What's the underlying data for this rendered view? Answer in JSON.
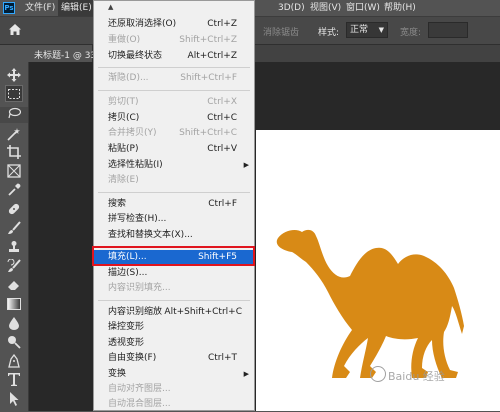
{
  "app": {
    "logo": "Ps"
  },
  "menubar": {
    "file": "文件(F)",
    "edit": "编辑(E)",
    "extra_3d": "3D(D)",
    "view": "视图(V)",
    "window": "窗口(W)",
    "help": "帮助(H)"
  },
  "options": {
    "mode_partial": "消除锯齿",
    "style_label": "样式:",
    "style_value": "正常",
    "width_label": "宽度:"
  },
  "document": {
    "tab_title": "未标题-1 @ 33"
  },
  "edit_menu": {
    "items": [
      {
        "label": "还原取消选择(O)",
        "shortcut": "Ctrl+Z"
      },
      {
        "label": "重做(O)",
        "shortcut": "Shift+Ctrl+Z"
      },
      {
        "label": "切换最终状态",
        "shortcut": "Alt+Ctrl+Z"
      },
      {
        "label": "渐隐(D)...",
        "shortcut": "Shift+Ctrl+F"
      },
      {
        "label": "剪切(T)",
        "shortcut": "Ctrl+X"
      },
      {
        "label": "拷贝(C)",
        "shortcut": "Ctrl+C"
      },
      {
        "label": "合并拷贝(Y)",
        "shortcut": "Shift+Ctrl+C"
      },
      {
        "label": "粘贴(P)",
        "shortcut": "Ctrl+V"
      },
      {
        "label": "选择性粘贴(I)",
        "shortcut": ""
      },
      {
        "label": "清除(E)",
        "shortcut": ""
      },
      {
        "label": "搜索",
        "shortcut": "Ctrl+F"
      },
      {
        "label": "拼写检查(H)...",
        "shortcut": ""
      },
      {
        "label": "查找和替换文本(X)...",
        "shortcut": ""
      },
      {
        "label": "填充(L)...",
        "shortcut": "Shift+F5"
      },
      {
        "label": "描边(S)...",
        "shortcut": ""
      },
      {
        "label": "内容识别填充...",
        "shortcut": ""
      },
      {
        "label": "内容识别缩放",
        "shortcut": "Alt+Shift+Ctrl+C"
      },
      {
        "label": "操控变形",
        "shortcut": ""
      },
      {
        "label": "透视变形",
        "shortcut": ""
      },
      {
        "label": "自由变换(F)",
        "shortcut": "Ctrl+T"
      },
      {
        "label": "变换",
        "shortcut": ""
      },
      {
        "label": "自动对齐图层...",
        "shortcut": ""
      },
      {
        "label": "自动混合图层...",
        "shortcut": ""
      }
    ]
  },
  "watermark": {
    "text": "Baidu 经验"
  },
  "colors": {
    "menu_highlight": "#1a68d0",
    "annotation_red": "#e0141e",
    "camel_fill": "#d88a16",
    "canvas": "#ffffff"
  },
  "icons": [
    "home-icon",
    "move-tool-icon",
    "marquee-tool-icon",
    "lasso-tool-icon",
    "magic-wand-icon",
    "crop-tool-icon",
    "frame-tool-icon",
    "eyedropper-icon",
    "healing-brush-icon",
    "brush-tool-icon",
    "clone-stamp-icon",
    "history-brush-icon",
    "eraser-icon",
    "gradient-icon",
    "blur-icon",
    "dodge-icon",
    "pen-tool-icon",
    "type-tool-icon",
    "path-select-icon"
  ]
}
